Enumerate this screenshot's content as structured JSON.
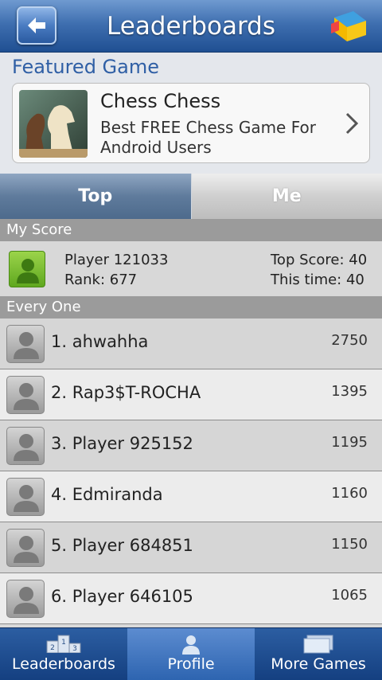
{
  "header": {
    "title": "Leaderboards"
  },
  "featured": {
    "section_title": "Featured Game",
    "game_name": "Chess Chess",
    "game_description": "Best FREE Chess Game For Android Users"
  },
  "tabs": [
    {
      "label": "Top",
      "selected": true
    },
    {
      "label": "Me",
      "selected": false
    }
  ],
  "my_score": {
    "section_title": "My Score",
    "player_name": "Player 121033",
    "rank": "Rank: 677",
    "top_score": "Top Score: 40",
    "this_time": "This time: 40"
  },
  "everyone": {
    "section_title": "Every One",
    "rows": [
      {
        "name": "1. ahwahha",
        "score": "2750"
      },
      {
        "name": "2. Rap3$T-ROCHA",
        "score": "1395"
      },
      {
        "name": "3. Player 925152",
        "score": "1195"
      },
      {
        "name": "4. Edmiranda",
        "score": "1160"
      },
      {
        "name": "5. Player 684851",
        "score": "1150"
      },
      {
        "name": "6. Player 646105",
        "score": "1065"
      }
    ]
  },
  "bottom_nav": [
    {
      "label": "Leaderboards",
      "icon": "podium-icon",
      "active": true
    },
    {
      "label": "Profile",
      "icon": "profile-icon",
      "active": false
    },
    {
      "label": "More Games",
      "icon": "screens-icon",
      "active": false
    }
  ],
  "colors": {
    "header_blue": "#3f6fb0",
    "featured_title": "#2f5fa5",
    "my_avatar_green": "#7cc433"
  }
}
